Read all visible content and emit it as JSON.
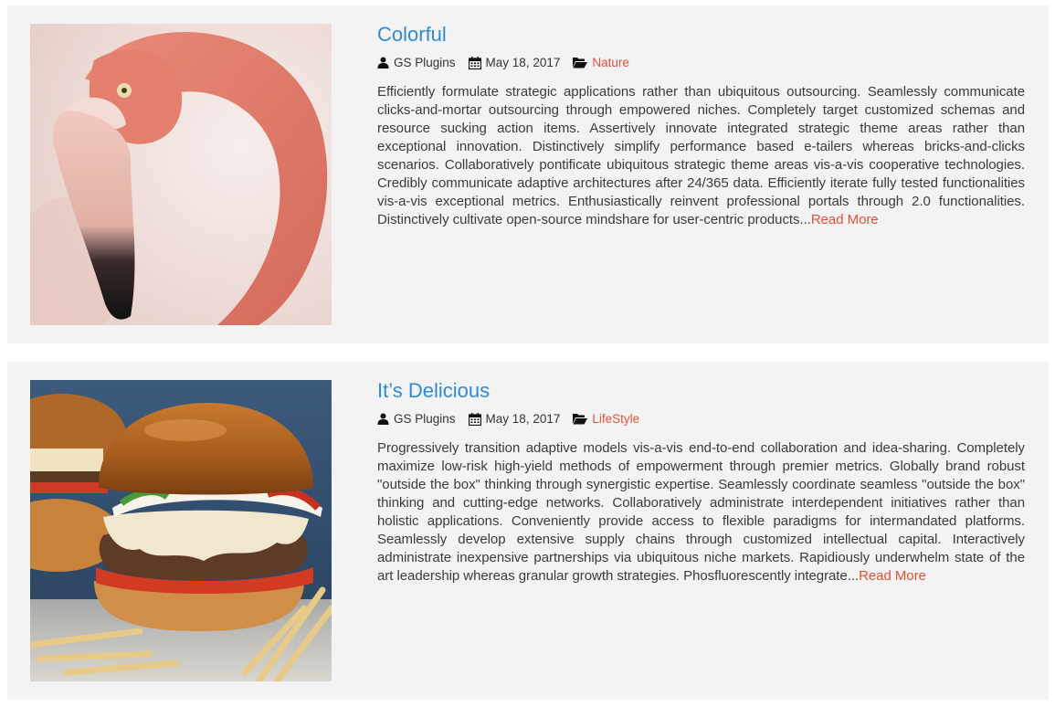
{
  "posts": [
    {
      "title": "Colorful",
      "author": "GS Plugins",
      "date": "May 18, 2017",
      "category": "Nature",
      "excerpt": "Efficiently formulate strategic applications rather than ubiquitous outsourcing. Seamlessly communicate clicks-and-mortar outsourcing through empowered niches. Completely target customized schemas and resource sucking action items. Assertively innovate integrated strategic theme areas rather than exceptional innovation. Distinctively simplify performance based e-tailers whereas bricks-and-clicks scenarios. Collaboratively pontificate ubiquitous strategic theme areas vis-a-vis cooperative technologies. Credibly communicate adaptive architectures after 24/365 data. Efficiently iterate fully tested functionalities vis-a-vis exceptional metrics. Enthusiastically reinvent professional portals through 2.0 functionalities. Distinctively cultivate open-source mindshare for user-centric products...",
      "read_more": "Read More",
      "image_subject": "flamingo"
    },
    {
      "title": "It’s Delicious",
      "author": "GS Plugins",
      "date": "May 18, 2017",
      "category": "LifeStyle",
      "excerpt": "Progressively transition adaptive models vis-a-vis end-to-end collaboration and idea-sharing. Completely maximize low-risk high-yield methods of empowerment through premier metrics. Globally brand robust \"outside the box\" thinking through synergistic expertise. Seamlessly coordinate seamless \"outside the box\" thinking and cutting-edge networks. Collaboratively administrate interdependent initiatives rather than holistic applications. Conveniently provide access to flexible paradigms for intermandated platforms. Seamlessly develop extensive supply chains through customized intellectual capital. Interactively administrate inexpensive partnerships via ubiquitous niche markets. Rapidiously underwhelm state of the art leadership whereas granular growth strategies. Phosfluorescently integrate...",
      "read_more": "Read More",
      "image_subject": "burger"
    }
  ],
  "icons": {
    "author": "user-icon",
    "date": "calendar-icon",
    "category": "folder-open-icon"
  },
  "colors": {
    "title": "#2f8ad8",
    "link": "#e0503a",
    "card_bg": "#f3f3f3"
  }
}
